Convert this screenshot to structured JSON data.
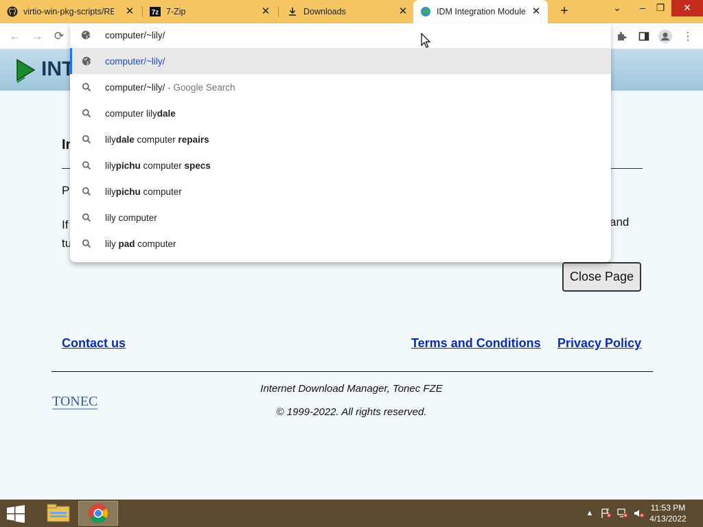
{
  "tabs": [
    {
      "title": "virtio-win-pkg-scripts/RE",
      "icon": "github-icon"
    },
    {
      "title": "7-Zip",
      "icon": "7zip-icon",
      "badge": "7z"
    },
    {
      "title": "Downloads",
      "icon": "download-icon"
    },
    {
      "title": "IDM Integration Module",
      "icon": "idm-globe-icon",
      "active": true
    }
  ],
  "toolbar": {
    "omnibox_value": "computer/~lily/"
  },
  "omnibox": {
    "suggestions": [
      {
        "icon": "globe-icon",
        "parts": [
          {
            "t": "computer/~lily/",
            "s": "blue"
          }
        ],
        "selected": true
      },
      {
        "icon": "search-icon",
        "parts": [
          {
            "t": "computer/~lily/",
            "s": ""
          },
          {
            "t": " - Google Search",
            "s": "dim"
          }
        ]
      },
      {
        "icon": "search-icon",
        "parts": [
          {
            "t": "computer lily",
            "s": ""
          },
          {
            "t": "dale",
            "s": "b"
          }
        ]
      },
      {
        "icon": "search-icon",
        "parts": [
          {
            "t": "lily",
            "s": ""
          },
          {
            "t": "dale",
            "s": "b"
          },
          {
            "t": " computer ",
            "s": ""
          },
          {
            "t": "repairs",
            "s": "b"
          }
        ]
      },
      {
        "icon": "search-icon",
        "parts": [
          {
            "t": "lily",
            "s": ""
          },
          {
            "t": "pichu",
            "s": "b"
          },
          {
            "t": " computer ",
            "s": ""
          },
          {
            "t": "specs",
            "s": "b"
          }
        ]
      },
      {
        "icon": "search-icon",
        "parts": [
          {
            "t": "lily",
            "s": ""
          },
          {
            "t": "pichu",
            "s": "b"
          },
          {
            "t": " computer",
            "s": ""
          }
        ]
      },
      {
        "icon": "search-icon",
        "parts": [
          {
            "t": "lily computer",
            "s": ""
          }
        ]
      },
      {
        "icon": "search-icon",
        "parts": [
          {
            "t": "lily ",
            "s": ""
          },
          {
            "t": "pad",
            "s": "b"
          },
          {
            "t": " computer",
            "s": ""
          }
        ]
      }
    ]
  },
  "page": {
    "banner_text": "INT",
    "heading_fragment": "In",
    "para1_fragment": "P",
    "para2_fragment_line1": "If",
    "para2_fragment_line2": "tu",
    "para2_fragment_end": "and",
    "close_button": "Close Page",
    "links": {
      "contact": "Contact us",
      "terms": "Terms and Conditions",
      "privacy": "Privacy Policy"
    },
    "footer_company": "Internet Download Manager, Tonec FZE",
    "footer_copyright": "© 1999-2022. All rights reserved.",
    "tonec_logo": "TONEC"
  },
  "taskbar": {
    "time": "11:53 PM",
    "date": "4/13/2022"
  },
  "colors": {
    "tabstrip": "#f6c663",
    "page_bg": "#f1f9fd",
    "link": "#0a2bb5",
    "taskbar": "#5b4a2f"
  }
}
